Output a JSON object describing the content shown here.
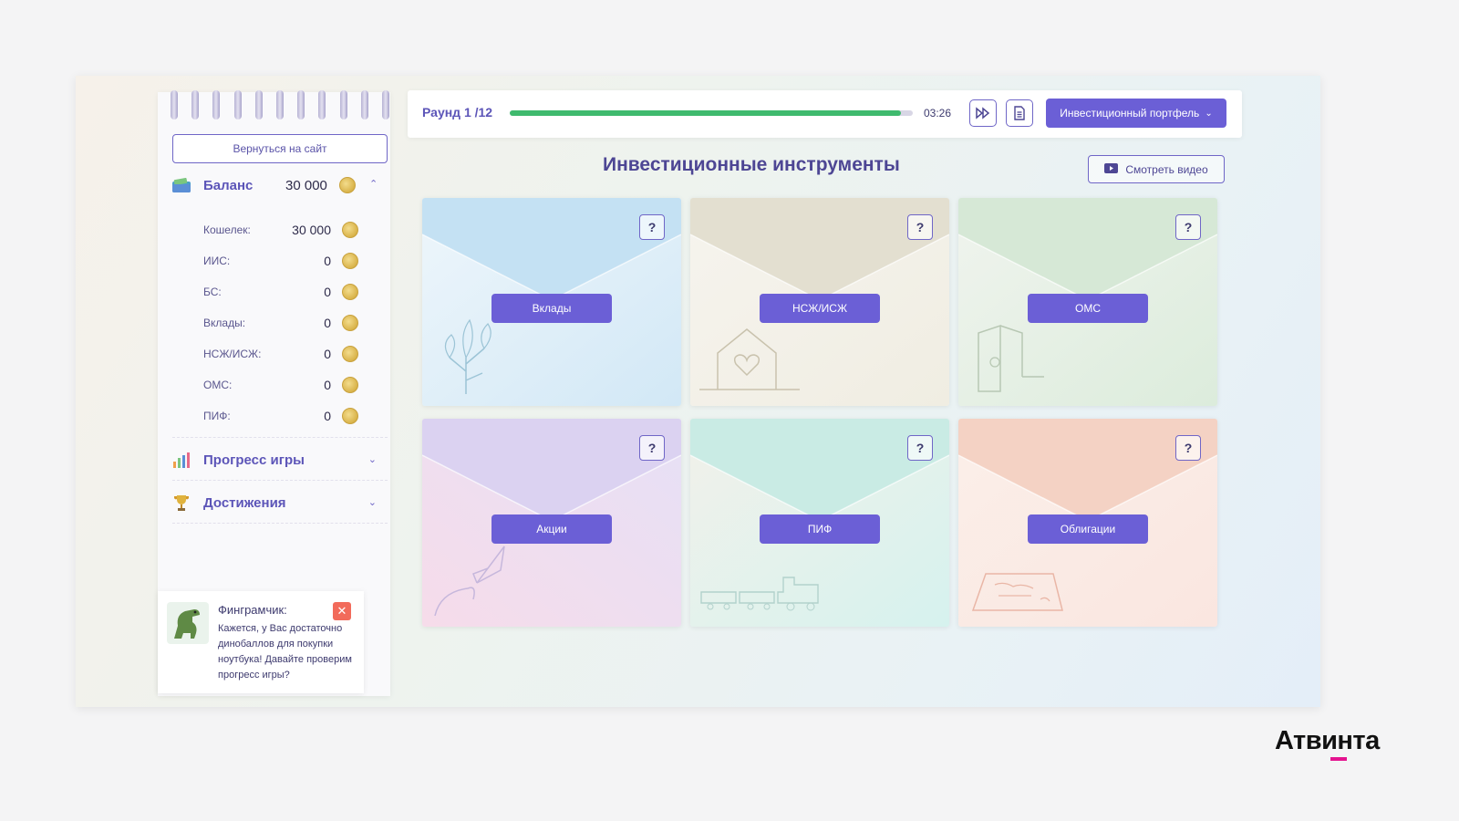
{
  "sidebar": {
    "back_label": "Вернуться на сайт",
    "balance": {
      "title": "Баланс",
      "value": "30 000"
    },
    "rows": [
      {
        "label": "Кошелек:",
        "value": "30 000"
      },
      {
        "label": "ИИС:",
        "value": "0"
      },
      {
        "label": "БС:",
        "value": "0"
      },
      {
        "label": "Вклады:",
        "value": "0"
      },
      {
        "label": "НСЖ/ИСЖ:",
        "value": "0"
      },
      {
        "label": "ОМС:",
        "value": "0"
      },
      {
        "label": "ПИФ:",
        "value": "0"
      }
    ],
    "progress_title": "Прогресс игры",
    "achievements_title": "Достижения"
  },
  "fingram": {
    "title": "Финграмчик:",
    "text": "Кажется, у Вас достаточно динобаллов для покупки ноутбука! Давайте проверим прогресс игры?",
    "close": "✕"
  },
  "topbar": {
    "round": "Раунд 1 /12",
    "progress_fraction": 0.97,
    "timer": "03:26",
    "portfolio_label": "Инвестиционный портфель"
  },
  "main": {
    "title": "Инвестиционные инструменты",
    "video_label": "Смотреть видео",
    "cards": [
      {
        "label": "Вклады",
        "q": "?",
        "color": "#bfdff2",
        "icon": "tree-icon"
      },
      {
        "label": "НСЖ/ИСЖ",
        "q": "?",
        "color": "#e5e1d2",
        "icon": "house-heart-icon"
      },
      {
        "label": "ОМС",
        "q": "?",
        "color": "#d8ead8",
        "icon": "door-icon"
      },
      {
        "label": "Акции",
        "q": "?",
        "color": "#dcd4f2",
        "icon": "rocket-icon"
      },
      {
        "label": "ПИФ",
        "q": "?",
        "color": "#c6ece6",
        "icon": "train-icon"
      },
      {
        "label": "Облигации",
        "q": "?",
        "color": "#f6d6c8",
        "icon": "document-icon"
      }
    ]
  },
  "brand": {
    "logo": "Атвинта"
  },
  "colors": {
    "accent": "#6b5fd6",
    "progress": "#3fba6e",
    "close": "#f26b5b"
  }
}
